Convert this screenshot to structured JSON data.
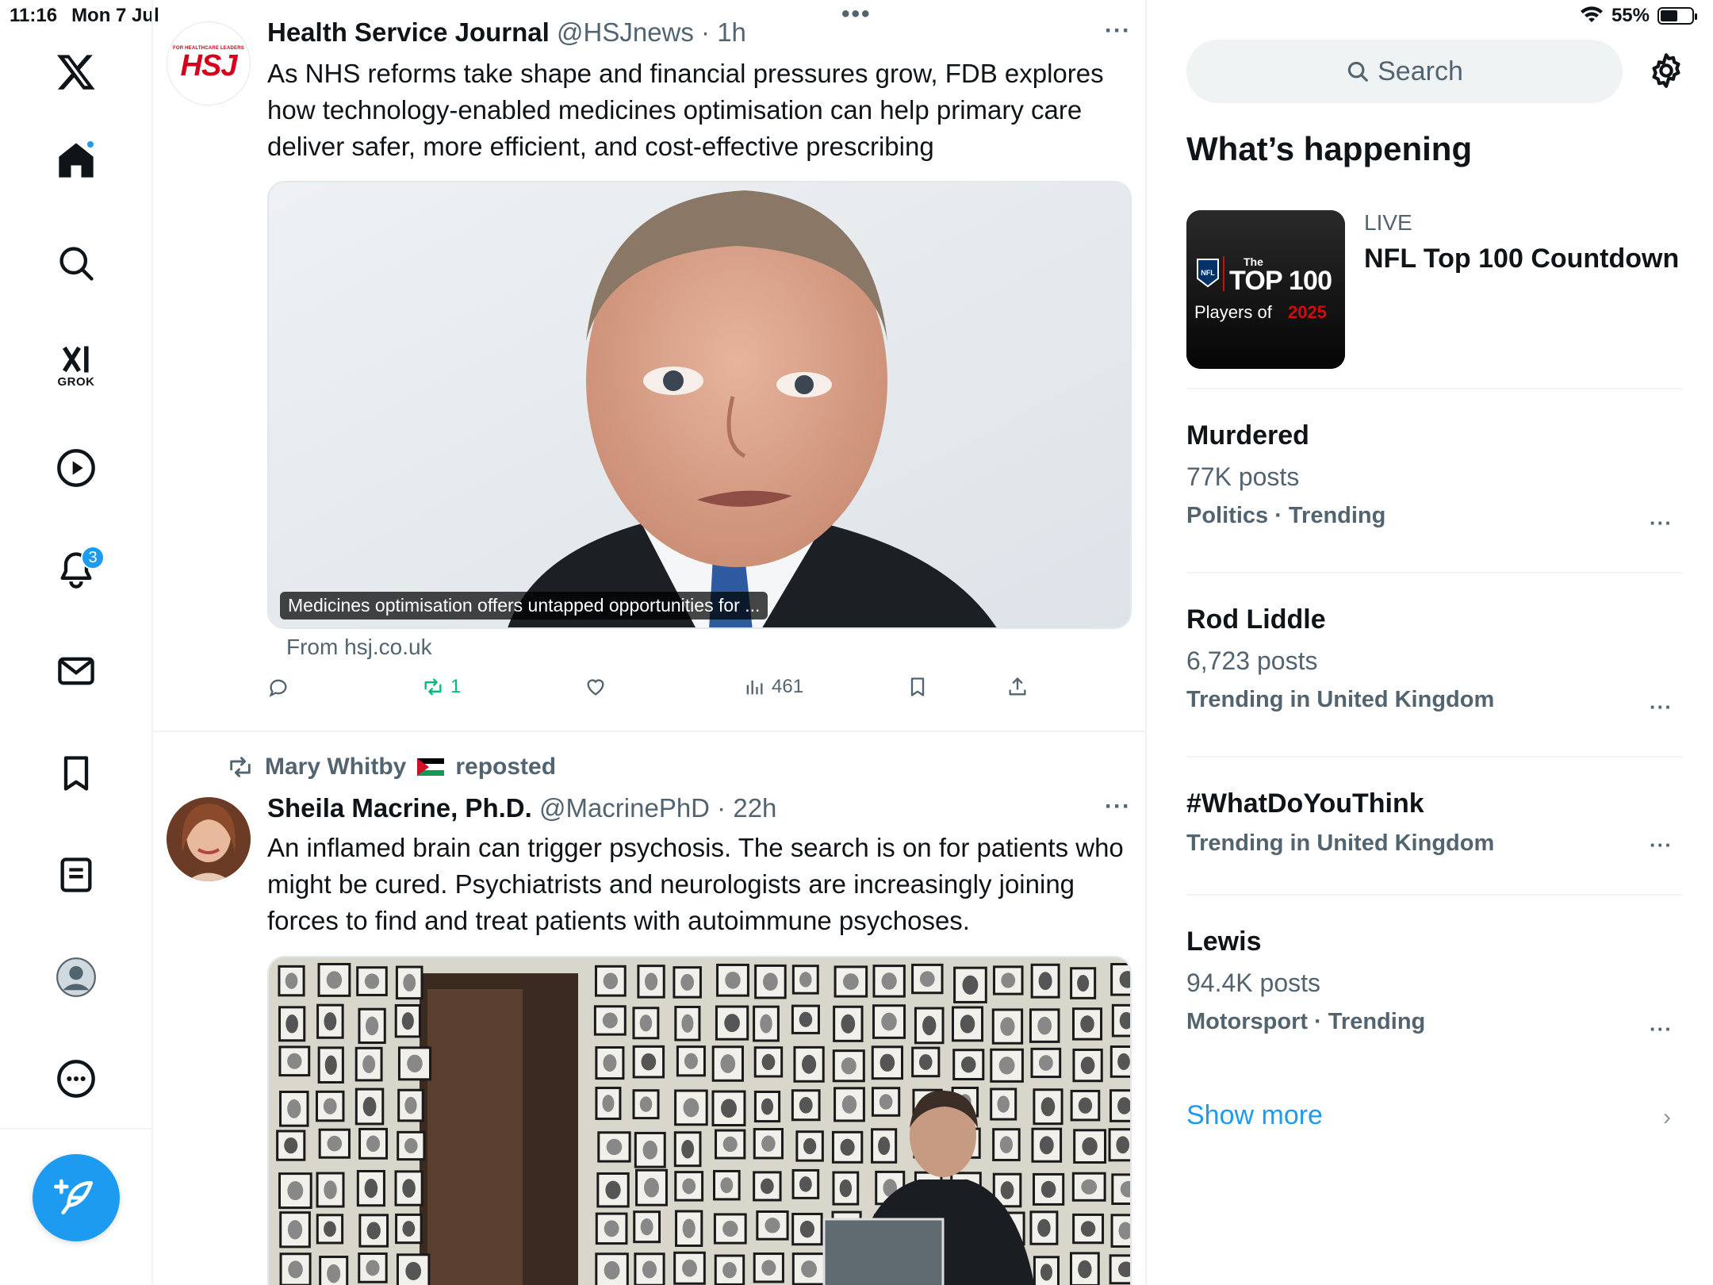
{
  "status_bar": {
    "time": "11:16",
    "date": "Mon 7 Jul",
    "battery": "55%",
    "battery_level": 0.55
  },
  "nav": {
    "grok_label": "GROK",
    "notifications_badge": "3",
    "colors": {
      "accent": "#1d9bf0"
    }
  },
  "tweets": [
    {
      "avatar_text_small": "FOR HEALTHCARE LEADERS",
      "avatar_text_big": "HSJ",
      "name": "Health Service Journal",
      "meta": "@HSJnews · 1h",
      "text": "As NHS reforms take shape and financial pressures grow, FDB explores how technology-enabled medicines optimisation can help primary care deliver safer, more efficient, and cost-effective prescribing",
      "media_caption": "Medicines optimisation offers untapped opportunities for ...",
      "from": "From hsj.co.uk",
      "actions": {
        "reposts": "1",
        "views": "461"
      }
    },
    {
      "reposted_by": "Mary Whitby",
      "reposted_suffix": "reposted",
      "name": "Sheila Macrine, Ph.D.",
      "meta": "@MacrinePhD · 22h",
      "text": "An inflamed brain can trigger psychosis. The search is on for patients who might be cured.  Psychiatrists and neurologists are increasingly joining forces to find and treat patients with autoimmune psychoses."
    }
  ],
  "sidebar": {
    "search_placeholder": "Search",
    "title": "What’s happening",
    "live": {
      "tag": "LIVE",
      "title": "NFL Top 100 Countdown",
      "thumb_the": "The",
      "thumb_top": "TOP 100",
      "thumb_players": "Players of",
      "thumb_year": "2025",
      "thumb_nfl": "NFL"
    },
    "trends": [
      {
        "name": "Murdered",
        "count": "77K posts",
        "context": "Politics · Trending"
      },
      {
        "name": "Rod Liddle",
        "count": "6,723 posts",
        "context": "Trending in United Kingdom"
      },
      {
        "name": "#WhatDoYouThink",
        "count": "",
        "context": "Trending in United Kingdom"
      },
      {
        "name": "Lewis",
        "count": "94.4K posts",
        "context": "Motorsport · Trending"
      }
    ],
    "show_more": "Show more"
  }
}
